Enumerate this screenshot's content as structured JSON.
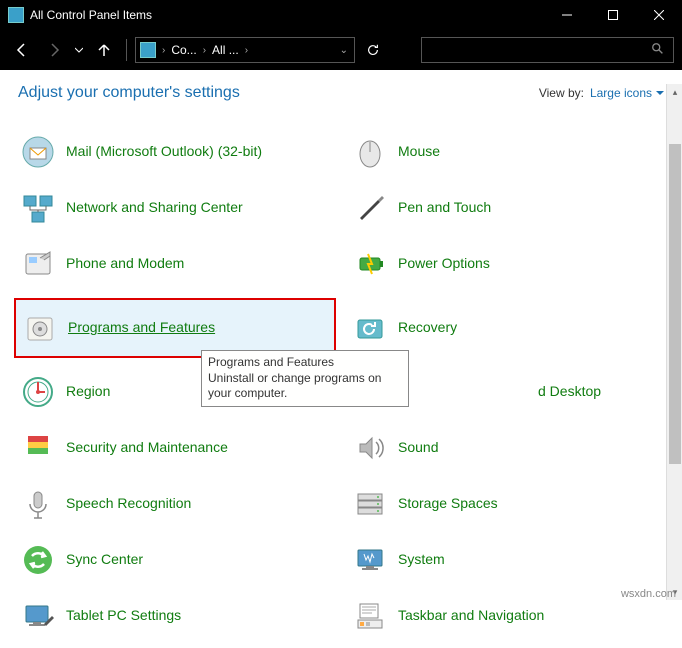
{
  "window": {
    "title": "All Control Panel Items"
  },
  "breadcrumb": {
    "part1": "Co...",
    "part2": "All ..."
  },
  "header": {
    "title": "Adjust your computer's settings",
    "viewby_label": "View by:",
    "viewby_value": "Large icons"
  },
  "items": {
    "mail": "Mail (Microsoft Outlook) (32-bit)",
    "mouse": "Mouse",
    "network": "Network and Sharing Center",
    "pen": "Pen and Touch",
    "phone": "Phone and Modem",
    "power": "Power Options",
    "programs": "Programs and Features",
    "recovery": "Recovery",
    "region": "Region",
    "remote": "d Desktop",
    "security": "Security and Maintenance",
    "sound": "Sound",
    "speech": "Speech Recognition",
    "storage": "Storage Spaces",
    "sync": "Sync Center",
    "system": "System",
    "tablet": "Tablet PC Settings",
    "taskbar": "Taskbar and Navigation"
  },
  "tooltip": {
    "title": "Programs and Features",
    "desc": "Uninstall or change programs on your computer."
  },
  "watermark": "wsxdn.com"
}
